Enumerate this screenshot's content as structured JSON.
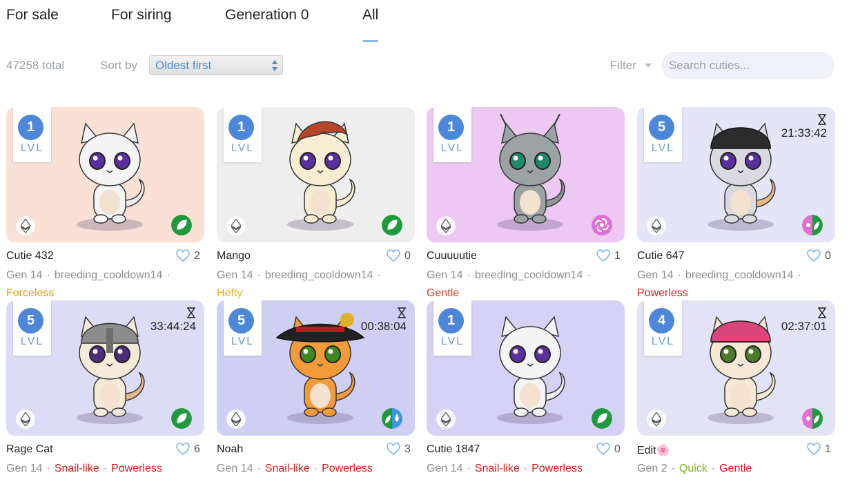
{
  "tabs": [
    "For sale",
    "For siring",
    "Generation 0",
    "All"
  ],
  "toolbar": {
    "total": "47258 total",
    "sort_label": "Sort by",
    "sort_value": "Oldest first",
    "filter_label": "Filter",
    "search_placeholder": "Search cuties..."
  },
  "level_label": "LVL",
  "cards": [
    {
      "name": "Cutie 432",
      "likes": "2",
      "level": "1",
      "gen": "Gen 14",
      "cooldown": "breeding_cooldown14",
      "trait": "Forceless",
      "trait_color": "#e39a10",
      "bg": "#fbe0d6",
      "element": "nature",
      "hat": "none",
      "timer": ""
    },
    {
      "name": "Mango",
      "likes": "0",
      "level": "1",
      "gen": "Gen 14",
      "cooldown": "breeding_cooldown14",
      "trait": "Hefty",
      "trait_color": "#e3b61a",
      "bg": "#eeeeee",
      "element": "nature",
      "hat": "hair",
      "timer": ""
    },
    {
      "name": "Cuuuuutie",
      "likes": "1",
      "level": "1",
      "gen": "Gen 14",
      "cooldown": "breeding_cooldown14",
      "trait": "Gentle",
      "trait_color": "#e03b1c",
      "bg": "#ecc8f2",
      "element": "air",
      "hat": "lynx",
      "timer": ""
    },
    {
      "name": "Cutie 647",
      "likes": "0",
      "level": "5",
      "gen": "Gen 14",
      "cooldown": "breeding_cooldown14",
      "trait": "Powerless",
      "trait_color": "#d81b1b",
      "bg": "#e4e6f8",
      "element": "air-nature",
      "hat": "cap-black",
      "timer": "21:33:42"
    },
    {
      "name": "Rage Cat",
      "likes": "6",
      "level": "5",
      "gen": "Gen 14",
      "t1": "Snail-like",
      "t2": "Powerless",
      "t1_class": "red",
      "t2_class": "red",
      "bg": "#dcdcf6",
      "element": "nature",
      "hat": "helmet",
      "timer": "33:44:24"
    },
    {
      "name": "Noah",
      "likes": "3",
      "level": "5",
      "gen": "Gen 14",
      "t1": "Snail-like",
      "t2": "Powerless",
      "t1_class": "red",
      "t2_class": "red",
      "bg": "#cfcff4",
      "element": "nature-water",
      "hat": "pirate",
      "timer": "00:38:04"
    },
    {
      "name": "Cutie 1847",
      "likes": "0",
      "level": "1",
      "gen": "Gen 14",
      "t1": "Snail-like",
      "t2": "Powerless",
      "t1_class": "red",
      "t2_class": "red",
      "bg": "#d6d2f6",
      "element": "nature",
      "hat": "none",
      "timer": ""
    },
    {
      "name": "Edit🌸",
      "likes": "1",
      "level": "4",
      "gen": "Gen 2",
      "t1": "Quick",
      "t2": "Gentle",
      "t1_class": "green",
      "t2_class": "red",
      "bg": "#e3e3f6",
      "element": "air-nature",
      "hat": "cap-pink",
      "timer": "02:37:01"
    }
  ],
  "colors": {
    "accent": "#4a8bd6",
    "level_badge": "#4d87d9",
    "nature": "#1e9a3d",
    "air": "#e06fd3",
    "water": "#3c96dd",
    "red_trait": "#d81b1b",
    "green_trait": "#7fb21f"
  },
  "icons": {
    "currency": "ethereum-icon",
    "like": "heart-icon",
    "timer": "hourglass-icon",
    "sort": "updown-arrows-icon",
    "filter": "caret-down-icon"
  }
}
